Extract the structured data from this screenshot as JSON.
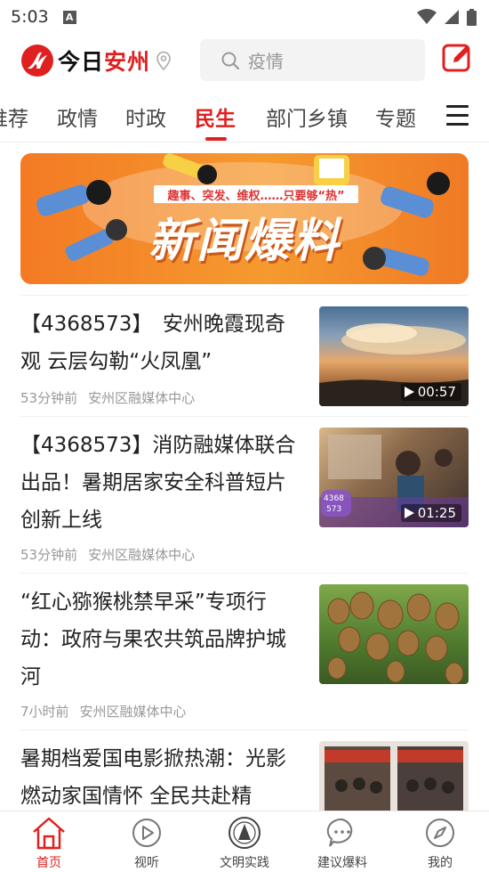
{
  "status_bar": {
    "time": "5:03",
    "notification_icon": "A"
  },
  "header": {
    "logo_text_1": "今日",
    "logo_text_2": "安州",
    "search_placeholder": "疫情"
  },
  "tabs": [
    {
      "label": "推荐",
      "active": false
    },
    {
      "label": "政情",
      "active": false
    },
    {
      "label": "时政",
      "active": false
    },
    {
      "label": "民生",
      "active": true
    },
    {
      "label": "部门乡镇",
      "active": false
    },
    {
      "label": "专题",
      "active": false
    }
  ],
  "banner": {
    "subtitle": "趣事、突发、维权……只要够“热”",
    "title": "新闻爆料"
  },
  "articles": [
    {
      "title": "【4368573】　安州晚霞现奇观 云层勾勒“火凤凰”",
      "time": "53分钟前",
      "source": "安州区融媒体中心",
      "duration": "00:57"
    },
    {
      "title": "【4368573】消防融媒体联合出品！暑期居家安全科普短片创新上线",
      "time": "53分钟前",
      "source": "安州区融媒体中心",
      "duration": "01:25",
      "thumb_code_1": "4368",
      "thumb_code_2": "573"
    },
    {
      "title": "“红心猕猴桃禁早采”专项行动：政府与果农共筑品牌护城河",
      "time": "7小时前",
      "source": "安州区融媒体中心"
    },
    {
      "title": "暑期档爱国电影掀热潮：光影燃动家国情怀 全民共赴精"
    }
  ],
  "bottom_nav": [
    {
      "label": "首页",
      "icon": "home-icon",
      "active": true
    },
    {
      "label": "视听",
      "icon": "play-circle-icon",
      "active": false
    },
    {
      "label": "文明实践",
      "icon": "emblem-icon",
      "active": false
    },
    {
      "label": "建议爆料",
      "icon": "chat-icon",
      "active": false
    },
    {
      "label": "我的",
      "icon": "compass-icon",
      "active": false
    }
  ],
  "colors": {
    "accent": "#e02020",
    "banner": "#f5912b"
  }
}
